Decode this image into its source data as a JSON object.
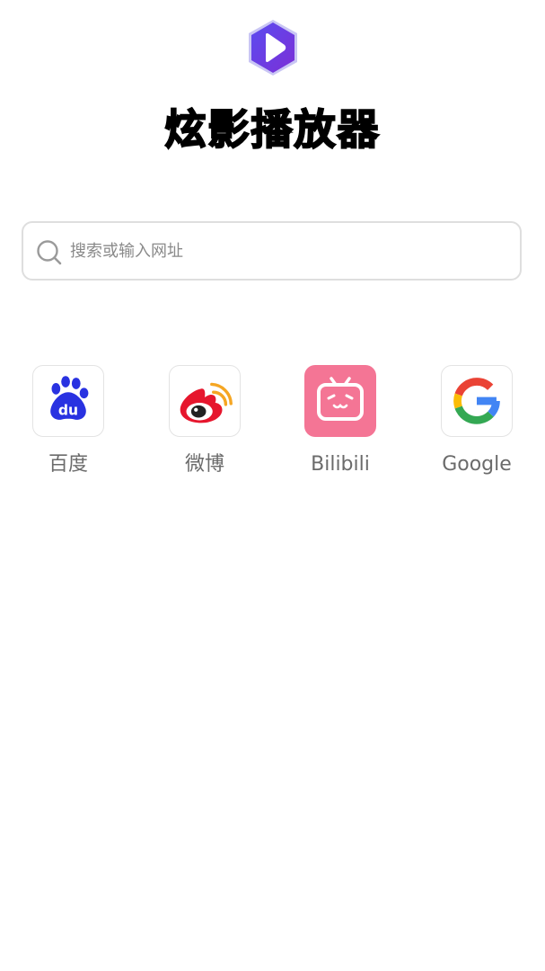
{
  "app": {
    "title": "炫影播放器",
    "logo_icon": "play-hexagon-icon",
    "logo_colors": [
      "#4f46e5",
      "#7c3aed"
    ]
  },
  "search": {
    "placeholder": "搜索或输入网址",
    "value": "",
    "icon": "search-icon"
  },
  "shortcuts": [
    {
      "label": "百度",
      "icon": "baidu-paw-icon",
      "color": "#2932e1"
    },
    {
      "label": "微博",
      "icon": "weibo-eye-icon",
      "color": "#e6162d"
    },
    {
      "label": "Bilibili",
      "icon": "bilibili-tv-icon",
      "color": "#f47595"
    },
    {
      "label": "Google",
      "icon": "google-g-icon",
      "color": "#4285f4"
    }
  ]
}
